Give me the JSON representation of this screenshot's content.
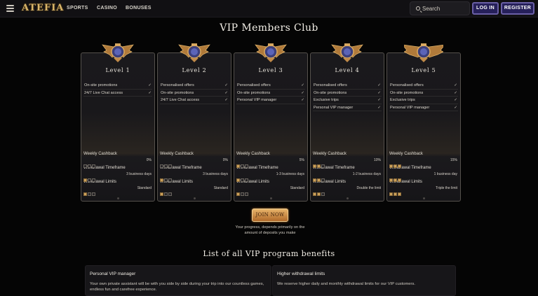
{
  "header": {
    "logo": "ATEFIA",
    "nav": [
      "SPORTS",
      "CASINO",
      "BONUSES"
    ],
    "search_label": "Search",
    "login_label": "LOG IN",
    "register_label": "REGISTER"
  },
  "title": "VIP Members Club",
  "stat_labels": {
    "cashback": "Weekly Cashback",
    "timeframe": "Withdrawal Timeframe",
    "limits": "Withdrawal Limits"
  },
  "levels": [
    {
      "name": "Level 1",
      "features": [
        "On-site promotions",
        "24/7 Live Chat access"
      ],
      "cashback": "0%",
      "cashback_stars": 0,
      "timeframe": "3 business days",
      "timeframe_stars": 1,
      "limits": "Standard",
      "limits_stars": 1
    },
    {
      "name": "Level 2",
      "features": [
        "Personalised offers",
        "On-site promotions",
        "24/7 Live Chat access"
      ],
      "cashback": "0%",
      "cashback_stars": 0,
      "timeframe": "3 business days",
      "timeframe_stars": 1,
      "limits": "Standard",
      "limits_stars": 1
    },
    {
      "name": "Level 3",
      "features": [
        "Personalised offers",
        "On-site promotions",
        "Personal VIP manager"
      ],
      "cashback": "5%",
      "cashback_stars": 1,
      "timeframe": "1-3 business days",
      "timeframe_stars": 1,
      "limits": "Standard",
      "limits_stars": 1
    },
    {
      "name": "Level 4",
      "features": [
        "Personalised offers",
        "On-site promotions",
        "Exclusive trips",
        "Personal VIP manager"
      ],
      "cashback": "10%",
      "cashback_stars": 2,
      "timeframe": "1-2 business days",
      "timeframe_stars": 2,
      "limits": "Double the limit",
      "limits_stars": 2
    },
    {
      "name": "Level 5",
      "features": [
        "Personalised offers",
        "On-site promotions",
        "Exclusive trips",
        "Personal VIP manager"
      ],
      "cashback": "15%",
      "cashback_stars": 3,
      "timeframe": "1 business day",
      "timeframe_stars": 3,
      "limits": "Triple the limit",
      "limits_stars": 3
    }
  ],
  "join_label": "JOIN NOW",
  "join_note": "Your progress, depends primarily on the amount of deposits you make",
  "benefits_title": "List of all VIP program benefits",
  "benefits": [
    {
      "title": "Personal VIP manager",
      "desc": "Your own private assistant will be with you side by side during your trip into our countless games, endless fun and carefree experience."
    },
    {
      "title": "Higher withdrawal limits",
      "desc": "We reserve higher daily and monthly withdrawal limits for our VIP customers."
    }
  ],
  "colors": {
    "background": "#050505",
    "gold": "#d8b56a",
    "button_purple": "#26205a",
    "join_orange": "#c98a44"
  }
}
